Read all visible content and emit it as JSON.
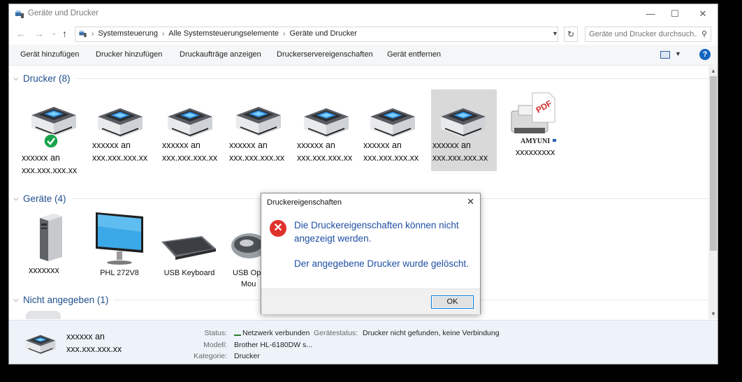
{
  "window": {
    "title": "Geräte und Drucker",
    "minimize": "—",
    "maximize": "☐",
    "close": "✕"
  },
  "nav": {
    "back": "←",
    "forward": "→",
    "recent": "⌄",
    "up": "↑"
  },
  "address": {
    "crumbs": [
      "Systemsteuerung",
      "Alle Systemsteuerungselemente",
      "Geräte und Drucker"
    ],
    "separator": "›",
    "search_placeholder": "Geräte und Drucker durchsuch..."
  },
  "commands": [
    "Gerät hinzufügen",
    "Drucker hinzufügen",
    "Druckaufträge anzeigen",
    "Druckerservereigenschaften",
    "Gerät entfernen"
  ],
  "help_label": "?",
  "groups": {
    "printers": "Drucker (8)",
    "devices": "Geräte (4)",
    "unspecified": "Nicht angegeben (1)"
  },
  "printers": [
    {
      "line1": "xxxxxx an",
      "line2": "xxx.xxx.xxx.xx",
      "default": true
    },
    {
      "line1": "xxxxxx an",
      "line2": "xxx.xxx.xxx.xx"
    },
    {
      "line1": "xxxxxx an",
      "line2": "xxx.xxx.xxx.xx"
    },
    {
      "line1": "xxxxxx an",
      "line2": "xxx.xxx.xxx.xx"
    },
    {
      "line1": "xxxxxx an",
      "line2": "xxx.xxx.xxx.xx"
    },
    {
      "line1": "xxxxxx an",
      "line2": "xxx.xxx.xxx.xx"
    },
    {
      "line1": "xxxxxx an",
      "line2": "xxx.xxx.xxx.xx",
      "selected": true
    },
    {
      "line1": "xxxxxxxxx",
      "logo_text": "AMYUNI",
      "pdf_text": "PDF"
    }
  ],
  "devices": [
    {
      "label": "xxxxxxx"
    },
    {
      "label": "PHL 272V8"
    },
    {
      "label": "USB Keyboard"
    },
    {
      "label": "USB Op",
      "label2": "Mou"
    }
  ],
  "details": {
    "name_line1": "xxxxxx an",
    "name_line2": "xxx.xxx.xxx.xx",
    "status_label": "Status:",
    "status_value": "Netzwerk verbunden",
    "devstatus_label": "Gerätestatus:",
    "devstatus_value": "Drucker nicht gefunden, keine Verbindung",
    "model_label": "Modell:",
    "model_value": "Brother HL-6180DW s...",
    "category_label": "Kategorie:",
    "category_value": "Drucker"
  },
  "dialog": {
    "title": "Druckereigenschaften",
    "close": "✕",
    "icon_glyph": "✕",
    "message": "Die Druckereigenschaften können nicht angezeigt werden.",
    "message2": "Der angegebene Drucker wurde gelöscht.",
    "ok": "OK"
  },
  "colors": {
    "accent": "#0078d7",
    "group_title": "#1e4e8c",
    "dialog_text": "#1f4fa3",
    "error": "#e0312b",
    "ok_check": "#16a34a"
  }
}
